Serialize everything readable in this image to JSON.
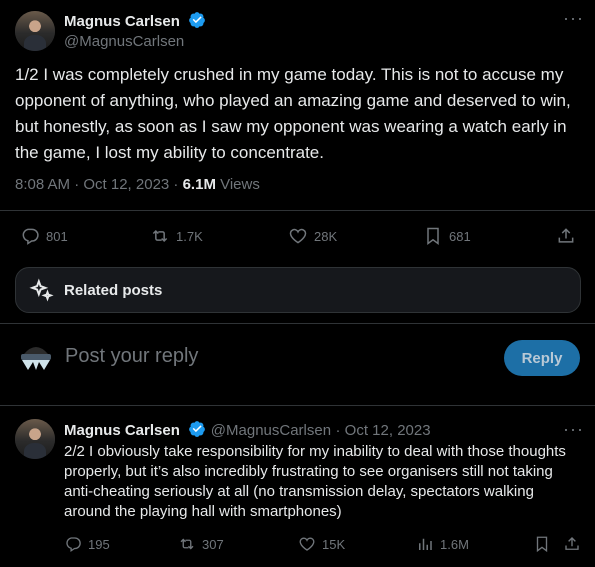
{
  "tweet1": {
    "author_name": "Magnus Carlsen",
    "author_handle": "@MagnusCarlsen",
    "text": "1/2 I was completely crushed in my game today. This is not to accuse my opponent of anything, who played an amazing game and deserved to win, but honestly, as soon as I saw my opponent was wearing a watch early in the game, I lost my ability to concentrate.",
    "time": "8:08 AM · Oct 12, 2023 · ",
    "views_count": "6.1M",
    "views_label": " Views",
    "replies": "801",
    "reposts": "1.7K",
    "likes": "28K",
    "bookmarks": "681"
  },
  "related": {
    "label": "Related posts"
  },
  "reply_box": {
    "placeholder": "Post your reply",
    "button": "Reply"
  },
  "tweet2": {
    "author_name": "Magnus Carlsen",
    "author_handle": "@MagnusCarlsen",
    "date": "· Oct 12, 2023",
    "text": "2/2 I obviously take responsibility for my inability to deal with those thoughts properly, but it’s also incredibly frustrating to see organisers still not taking anti-cheating seriously at all (no transmission delay, spectators walking around the playing hall with smartphones)",
    "replies": "195",
    "reposts": "307",
    "likes": "15K",
    "views": "1.6M"
  },
  "colors": {
    "accent": "#1d9bf0",
    "muted": "#71767b",
    "divider": "#2f3336"
  }
}
